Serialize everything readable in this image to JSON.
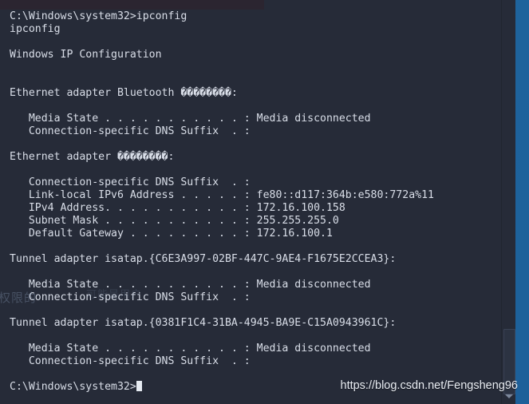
{
  "window": {
    "kind": "windows-command-prompt",
    "background_color": "#262b38",
    "text_color": "#d9dee8",
    "desktop_color": "#1f6ba5"
  },
  "terminal": {
    "lines": [
      "C:\\Windows\\system32>ipconfig",
      "ipconfig",
      "",
      "Windows IP Configuration",
      "",
      "",
      "Ethernet adapter Bluetooth ��������:",
      "",
      "   Media State . . . . . . . . . . . : Media disconnected",
      "   Connection-specific DNS Suffix  . :",
      "",
      "Ethernet adapter ��������:",
      "",
      "   Connection-specific DNS Suffix  . :",
      "   Link-local IPv6 Address . . . . . : fe80::d117:364b:e580:772a%11",
      "   IPv4 Address. . . . . . . . . . . : 172.16.100.158",
      "   Subnet Mask . . . . . . . . . . . : 255.255.255.0",
      "   Default Gateway . . . . . . . . . : 172.16.100.1",
      "",
      "Tunnel adapter isatap.{C6E3A997-02BF-447C-9AE4-F1675E2CCEA3}:",
      "",
      "   Media State . . . . . . . . . . . : Media disconnected",
      "   Connection-specific DNS Suffix  . :",
      "",
      "Tunnel adapter isatap.{0381F1C4-31BA-4945-BA9E-C15A0943961C}:",
      "",
      "   Media State . . . . . . . . . . . : Media disconnected",
      "   Connection-specific DNS Suffix  . :",
      ""
    ],
    "prompt_final": "C:\\Windows\\system32>",
    "command_entered": "ipconfig",
    "section_title": "Windows IP Configuration",
    "adapters": [
      {
        "name": "Ethernet adapter Bluetooth ��������",
        "media_state": "Media disconnected",
        "dns_suffix": ""
      },
      {
        "name": "Ethernet adapter ��������",
        "dns_suffix": "",
        "ipv6_link_local": "fe80::d117:364b:e580:772a%11",
        "ipv4_address": "172.16.100.158",
        "subnet_mask": "255.255.255.0",
        "default_gateway": "172.16.100.1"
      },
      {
        "name": "Tunnel adapter isatap.{C6E3A997-02BF-447C-9AE4-F1675E2CCEA3}",
        "media_state": "Media disconnected",
        "dns_suffix": ""
      },
      {
        "name": "Tunnel adapter isatap.{0381F1C4-31BA-4945-BA9E-C15A0943961C}",
        "media_state": "Media disconnected",
        "dns_suffix": ""
      }
    ]
  },
  "watermarks": {
    "url": "https://blog.csdn.net/Fengsheng96",
    "cn_left": "权限的",
    "cn_faint": "可能是用户"
  }
}
